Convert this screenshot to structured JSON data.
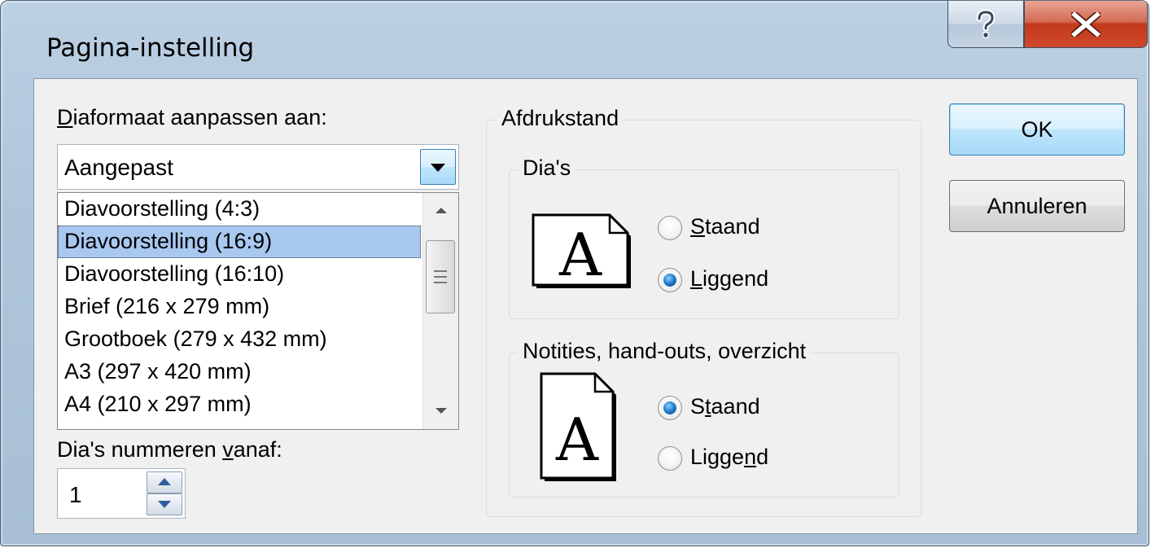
{
  "window": {
    "title": "Pagina-instelling",
    "help_glyph": "?",
    "close_glyph": "X"
  },
  "size": {
    "label_pre": "",
    "label_mnemonic": "D",
    "label_post": "iaformaat aanpassen aan:",
    "combo_value": "Aangepast",
    "options": [
      "Diavoorstelling (4:3)",
      "Diavoorstelling (16:9)",
      "Diavoorstelling (16:10)",
      "Brief (216 x 279 mm)",
      "Grootboek (279 x 432 mm)",
      "A3 (297 x 420 mm)",
      "A4 (210 x 297 mm)"
    ],
    "selected_index": 1
  },
  "numbering": {
    "label_pre": "Dia's nummeren ",
    "label_mnemonic": "v",
    "label_post": "anaf:",
    "value": "1"
  },
  "orientation": {
    "legend": "Afdrukstand",
    "slides": {
      "legend": "Dia's",
      "icon_letter": "A",
      "portrait": {
        "pre": "",
        "mnemonic": "S",
        "post": "taand",
        "checked": false
      },
      "landscape": {
        "pre": "",
        "mnemonic": "L",
        "post": "iggend",
        "checked": true
      }
    },
    "notes": {
      "legend": "Notities, hand-outs, overzicht",
      "icon_letter": "A",
      "portrait": {
        "pre": "S",
        "mnemonic": "t",
        "post": "aand",
        "checked": true
      },
      "landscape": {
        "pre": "Ligge",
        "mnemonic": "n",
        "post": "d",
        "checked": false
      }
    }
  },
  "buttons": {
    "ok": "OK",
    "cancel": "Annuleren"
  },
  "icons": {
    "help": "help-icon",
    "close": "close-icon",
    "dropdown": "chevron-down-icon",
    "scroll_up": "scroll-up-icon",
    "scroll_down": "scroll-down-icon",
    "spin_up": "spin-up-icon",
    "spin_down": "spin-down-icon",
    "page_landscape": "landscape-page-icon",
    "page_portrait": "portrait-page-icon"
  },
  "colors": {
    "titlebar": "#b0c6dc",
    "close_button": "#c8452a",
    "selection": "#a8c8f0",
    "radio_checked": "#1f78c8"
  }
}
